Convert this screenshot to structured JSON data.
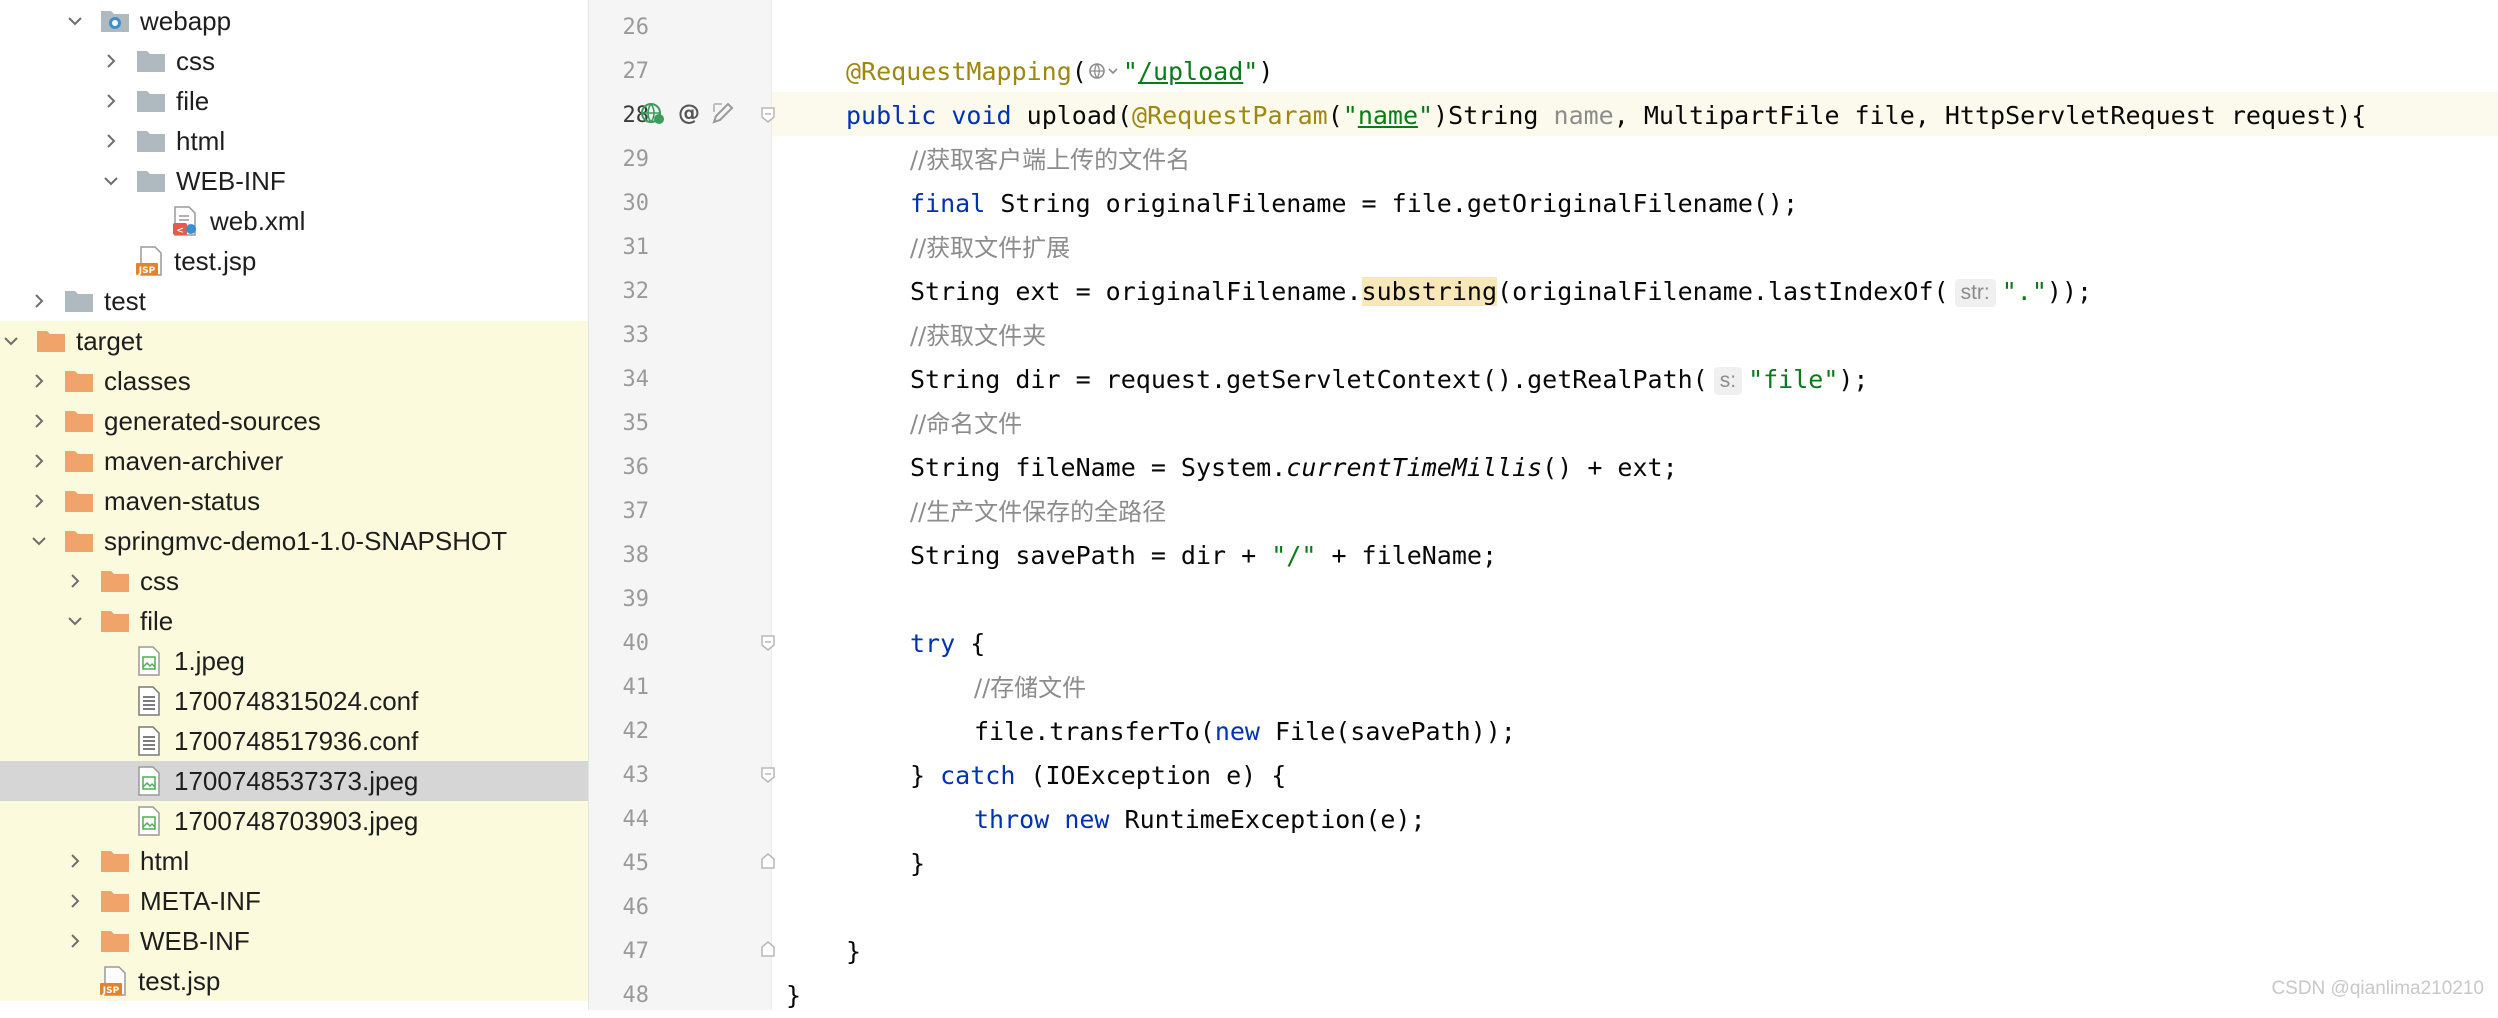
{
  "tree": {
    "rows": [
      {
        "label": "webapp",
        "indent": 1,
        "chevron": "down",
        "icon": "web-folder-icon",
        "state": "normal"
      },
      {
        "label": "css",
        "indent": 2,
        "chevron": "right",
        "icon": "folder-icon",
        "state": "normal"
      },
      {
        "label": "file",
        "indent": 2,
        "chevron": "right",
        "icon": "folder-icon",
        "state": "normal"
      },
      {
        "label": "html",
        "indent": 2,
        "chevron": "right",
        "icon": "folder-icon",
        "state": "normal"
      },
      {
        "label": "WEB-INF",
        "indent": 2,
        "chevron": "down",
        "icon": "folder-icon",
        "state": "normal"
      },
      {
        "label": "web.xml",
        "indent": 3,
        "chevron": "none",
        "icon": "xml-file-icon",
        "state": "normal"
      },
      {
        "label": "test.jsp",
        "indent": 2,
        "chevron": "none",
        "icon": "jsp-file-icon",
        "state": "normal"
      },
      {
        "label": "test",
        "indent": 0,
        "chevron": "right",
        "icon": "folder-icon",
        "state": "normal"
      },
      {
        "label": "target",
        "indent": -1,
        "chevron": "down",
        "icon": "excluded-folder-icon",
        "state": "target"
      },
      {
        "label": "classes",
        "indent": 0,
        "chevron": "right",
        "icon": "excluded-folder-icon",
        "state": "target"
      },
      {
        "label": "generated-sources",
        "indent": 0,
        "chevron": "right",
        "icon": "excluded-folder-icon",
        "state": "target"
      },
      {
        "label": "maven-archiver",
        "indent": 0,
        "chevron": "right",
        "icon": "excluded-folder-icon",
        "state": "target"
      },
      {
        "label": "maven-status",
        "indent": 0,
        "chevron": "right",
        "icon": "excluded-folder-icon",
        "state": "target"
      },
      {
        "label": "springmvc-demo1-1.0-SNAPSHOT",
        "indent": 0,
        "chevron": "down",
        "icon": "excluded-folder-icon",
        "state": "target"
      },
      {
        "label": "css",
        "indent": 1,
        "chevron": "right",
        "icon": "excluded-folder-icon",
        "state": "target"
      },
      {
        "label": "file",
        "indent": 1,
        "chevron": "down",
        "icon": "excluded-folder-icon",
        "state": "target"
      },
      {
        "label": "1.jpeg",
        "indent": 2,
        "chevron": "none",
        "icon": "image-file-icon",
        "state": "target"
      },
      {
        "label": "1700748315024.conf",
        "indent": 2,
        "chevron": "none",
        "icon": "text-file-icon",
        "state": "target"
      },
      {
        "label": "1700748517936.conf",
        "indent": 2,
        "chevron": "none",
        "icon": "text-file-icon",
        "state": "target"
      },
      {
        "label": "1700748537373.jpeg",
        "indent": 2,
        "chevron": "none",
        "icon": "image-file-icon",
        "state": "selected"
      },
      {
        "label": "1700748703903.jpeg",
        "indent": 2,
        "chevron": "none",
        "icon": "image-file-icon",
        "state": "target"
      },
      {
        "label": "html",
        "indent": 1,
        "chevron": "right",
        "icon": "excluded-folder-icon",
        "state": "target"
      },
      {
        "label": "META-INF",
        "indent": 1,
        "chevron": "right",
        "icon": "excluded-folder-icon",
        "state": "target"
      },
      {
        "label": "WEB-INF",
        "indent": 1,
        "chevron": "right",
        "icon": "excluded-folder-icon",
        "state": "target"
      },
      {
        "label": "test.jsp",
        "indent": 1,
        "chevron": "none",
        "icon": "jsp-file-icon",
        "state": "target"
      }
    ]
  },
  "editor": {
    "current_line": "28",
    "lines": [
      {
        "n": "26",
        "parts": []
      },
      {
        "n": "27",
        "parts": [
          {
            "t": "@RequestMapping",
            "c": "ann"
          },
          {
            "t": "(",
            "c": ""
          },
          {
            "t": "globe",
            "c": "globe"
          },
          {
            "t": "\"",
            "c": "str"
          },
          {
            "t": "/upload",
            "c": "strlink"
          },
          {
            "t": "\"",
            "c": "str"
          },
          {
            "t": ")",
            "c": ""
          }
        ]
      },
      {
        "n": "28",
        "parts": [
          {
            "t": "public",
            "c": "kw"
          },
          {
            "t": " ",
            "c": ""
          },
          {
            "t": "void",
            "c": "kw"
          },
          {
            "t": " upload(",
            "c": ""
          },
          {
            "t": "@RequestParam",
            "c": "ann"
          },
          {
            "t": "(",
            "c": ""
          },
          {
            "t": "\"",
            "c": "str"
          },
          {
            "t": "name",
            "c": "strlink"
          },
          {
            "t": "\"",
            "c": "str"
          },
          {
            "t": ")String ",
            "c": ""
          },
          {
            "t": "name",
            "c": "param-unused"
          },
          {
            "t": ", MultipartFile file, HttpServletRequest request){",
            "c": ""
          }
        ]
      },
      {
        "n": "29",
        "parts": [
          {
            "t": "//获取客户端上传的文件名",
            "c": "cm"
          }
        ]
      },
      {
        "n": "30",
        "parts": [
          {
            "t": "final",
            "c": "kw"
          },
          {
            "t": " String originalFilename = file.getOriginalFilename();",
            "c": ""
          }
        ]
      },
      {
        "n": "31",
        "parts": [
          {
            "t": "//获取文件扩展",
            "c": "cm"
          }
        ]
      },
      {
        "n": "32",
        "parts": [
          {
            "t": "String ext = originalFilename.",
            "c": ""
          },
          {
            "t": "substring",
            "c": "hl"
          },
          {
            "t": "(originalFilename.lastIndexOf(",
            "c": ""
          },
          {
            "t": "str:",
            "c": "hint"
          },
          {
            "t": "\".\"",
            "c": "str"
          },
          {
            "t": "));",
            "c": ""
          }
        ]
      },
      {
        "n": "33",
        "parts": [
          {
            "t": "//获取文件夹",
            "c": "cm"
          }
        ]
      },
      {
        "n": "34",
        "parts": [
          {
            "t": "String dir = request.getServletContext().getRealPath(",
            "c": ""
          },
          {
            "t": "s:",
            "c": "hint"
          },
          {
            "t": "\"file\"",
            "c": "str"
          },
          {
            "t": ");",
            "c": ""
          }
        ]
      },
      {
        "n": "35",
        "parts": [
          {
            "t": "//命名文件",
            "c": "cm"
          }
        ]
      },
      {
        "n": "36",
        "parts": [
          {
            "t": "String fileName = System.",
            "c": ""
          },
          {
            "t": "currentTimeMillis",
            "c": "ital"
          },
          {
            "t": "() + ext;",
            "c": ""
          }
        ]
      },
      {
        "n": "37",
        "parts": [
          {
            "t": "//生产文件保存的全路径",
            "c": "cm"
          }
        ]
      },
      {
        "n": "38",
        "parts": [
          {
            "t": "String savePath = dir + ",
            "c": ""
          },
          {
            "t": "\"/\"",
            "c": "str"
          },
          {
            "t": " + fileName;",
            "c": ""
          }
        ]
      },
      {
        "n": "39",
        "parts": []
      },
      {
        "n": "40",
        "parts": [
          {
            "t": "try",
            "c": "kw"
          },
          {
            "t": " {",
            "c": ""
          }
        ]
      },
      {
        "n": "41",
        "parts": [
          {
            "t": "//存储文件",
            "c": "cm"
          }
        ]
      },
      {
        "n": "42",
        "parts": [
          {
            "t": "file.transferTo(",
            "c": ""
          },
          {
            "t": "new",
            "c": "kw"
          },
          {
            "t": " File(savePath));",
            "c": ""
          }
        ]
      },
      {
        "n": "43",
        "parts": [
          {
            "t": "} ",
            "c": ""
          },
          {
            "t": "catch",
            "c": "kw"
          },
          {
            "t": " (IOException e) {",
            "c": ""
          }
        ]
      },
      {
        "n": "44",
        "parts": [
          {
            "t": "throw",
            "c": "kw"
          },
          {
            "t": " ",
            "c": ""
          },
          {
            "t": "new",
            "c": "kw"
          },
          {
            "t": " RuntimeException(e);",
            "c": ""
          }
        ]
      },
      {
        "n": "45",
        "parts": [
          {
            "t": "}",
            "c": ""
          }
        ]
      },
      {
        "n": "46",
        "parts": []
      },
      {
        "n": "47",
        "parts": [
          {
            "t": "}",
            "c": ""
          }
        ]
      },
      {
        "n": "48",
        "parts": [
          {
            "t": "}",
            "c": ""
          }
        ]
      }
    ],
    "gutter_icons": [
      "endpoint-globe-icon",
      "at-sign-icon",
      "edit-pencil-icon"
    ]
  },
  "colors": {
    "target_highlight": "#fbfadc",
    "selected_row": "#d6d6d6",
    "keyword": "#0033b3",
    "annotation": "#9e880d",
    "string": "#067d17",
    "comment": "#8c8c8c",
    "excluded_folder": "#f0a46b",
    "plain_folder": "#aeb9c0"
  },
  "watermark": "CSDN @qianlima210210"
}
